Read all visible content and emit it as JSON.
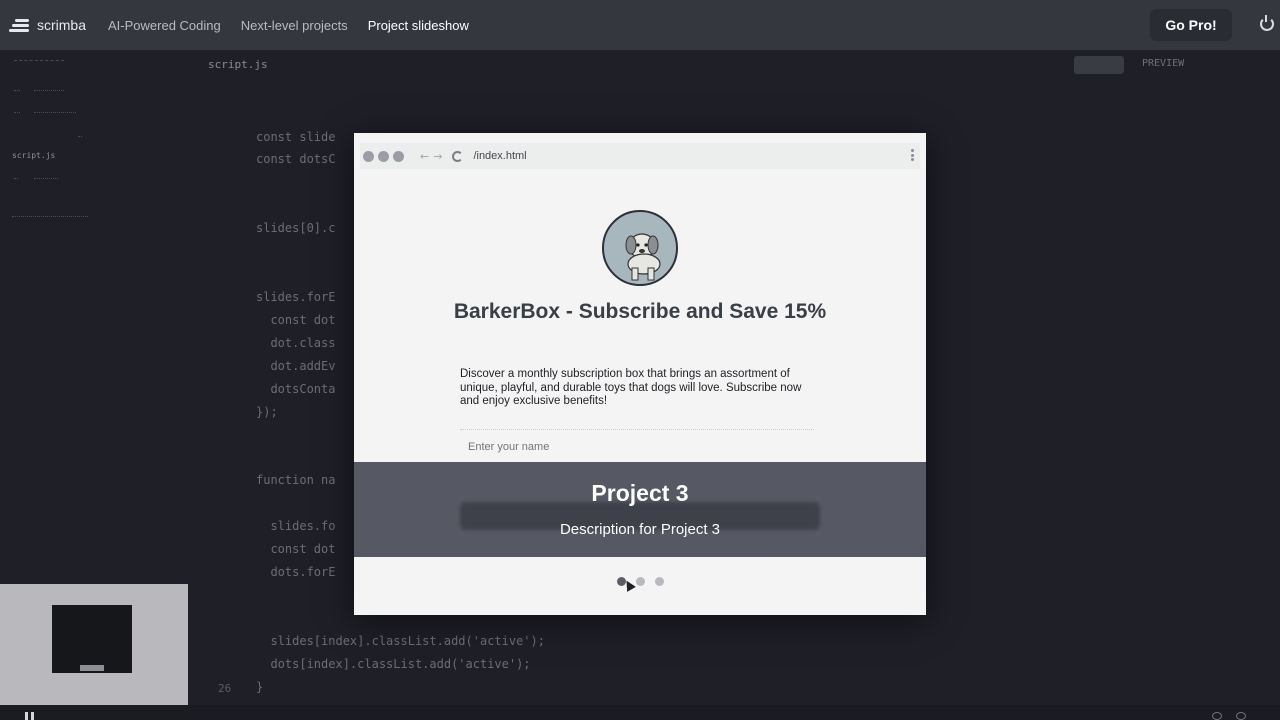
{
  "app": {
    "name": "scrimba"
  },
  "header": {
    "breadcrumbs": [
      {
        "label": "AI-Powered Coding"
      },
      {
        "label": "Next-level projects"
      },
      {
        "label": "Project slideshow"
      }
    ],
    "go_pro_label": "Go Pro!"
  },
  "sidebar": {
    "files": [
      {
        "label": "script.js"
      }
    ]
  },
  "editor": {
    "file_tab": "script.js",
    "preview_label": "PREVIEW",
    "line_number": "26",
    "code_lines": [
      "const slide",
      "const dotsC",
      "slides[0].c",
      "slides.forE",
      "  const dot",
      "  dot.class",
      "  dot.addEv",
      "  dotsConta",
      "});",
      "function na",
      "  slides.fo",
      "  const dot",
      "  dots.forE",
      "  slides[index].classList.add('active');",
      "  dots[index].classList.add('active');",
      "}"
    ]
  },
  "preview": {
    "url": "/index.html",
    "headline": "BarkerBox - Subscribe and Save 15%",
    "description": "Discover a monthly subscription box that brings an assortment of unique, playful, and durable toys that dogs will love. Subscribe now and enjoy exclusive benefits!",
    "name_placeholder": "Enter your name",
    "slide": {
      "title": "Project 3",
      "description": "Description for Project 3"
    },
    "slider": {
      "count": 3,
      "active_index": 0
    }
  },
  "colors": {
    "topbar": "#35373f",
    "editor_bg": "#1e1f27",
    "overlay": "#484a56"
  }
}
